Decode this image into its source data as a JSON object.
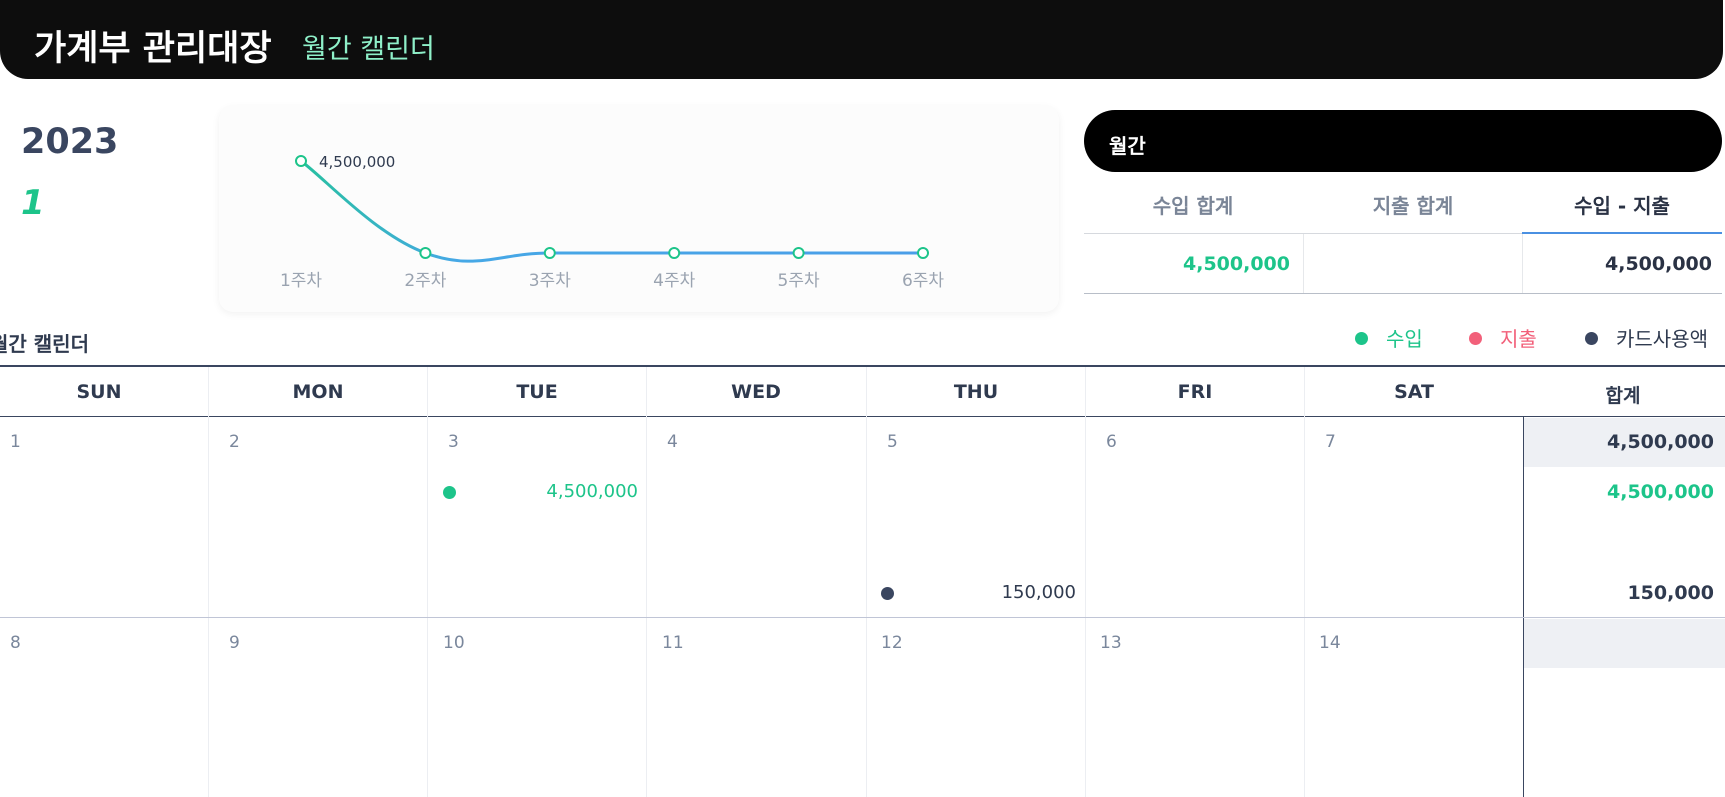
{
  "header": {
    "title": "가계부 관리대장",
    "subtitle": "월간 캘린더"
  },
  "period": {
    "year": "2023",
    "month": "1"
  },
  "colors": {
    "income": "#1dc48a",
    "expense": "#f2607a",
    "card": "#3a4660",
    "line": "#4aa3e8"
  },
  "chart_data": {
    "type": "line",
    "categories": [
      "1주차",
      "2주차",
      "3주차",
      "4주차",
      "5주차",
      "6주차"
    ],
    "values": [
      4500000,
      0,
      0,
      0,
      0,
      0
    ],
    "data_labels": [
      "4,500,000",
      "",
      "",
      "",
      "",
      ""
    ],
    "ylim": [
      0,
      4500000
    ],
    "grid": false
  },
  "summary": {
    "title": "월간",
    "columns": [
      "수입 합계",
      "지출 합계",
      "수입 - 지출"
    ],
    "values": [
      "4,500,000",
      "",
      "4,500,000"
    ],
    "active_tab": "수입 - 지출"
  },
  "calendar": {
    "title": "월간 캘린더",
    "legend": [
      {
        "label": "수입",
        "color": "#1dc48a"
      },
      {
        "label": "지출",
        "color": "#f2607a"
      },
      {
        "label": "카드사용액",
        "color": "#3a4660"
      }
    ],
    "day_headers": [
      "SUN",
      "MON",
      "TUE",
      "WED",
      "THU",
      "FRI",
      "SAT",
      "합계"
    ],
    "weeks": [
      {
        "dates": [
          "1",
          "2",
          "3",
          "4",
          "5",
          "6",
          "7"
        ],
        "entries": [
          {
            "day_index": 2,
            "type": "income",
            "amount": "4,500,000"
          },
          {
            "day_index": 4,
            "type": "card",
            "amount": "150,000"
          }
        ],
        "totals": {
          "net": "4,500,000",
          "income": "4,500,000",
          "card": "150,000"
        }
      },
      {
        "dates": [
          "8",
          "9",
          "10",
          "11",
          "12",
          "13",
          "14"
        ],
        "entries": [],
        "totals": {
          "net": "",
          "income": "",
          "card": ""
        }
      }
    ]
  }
}
